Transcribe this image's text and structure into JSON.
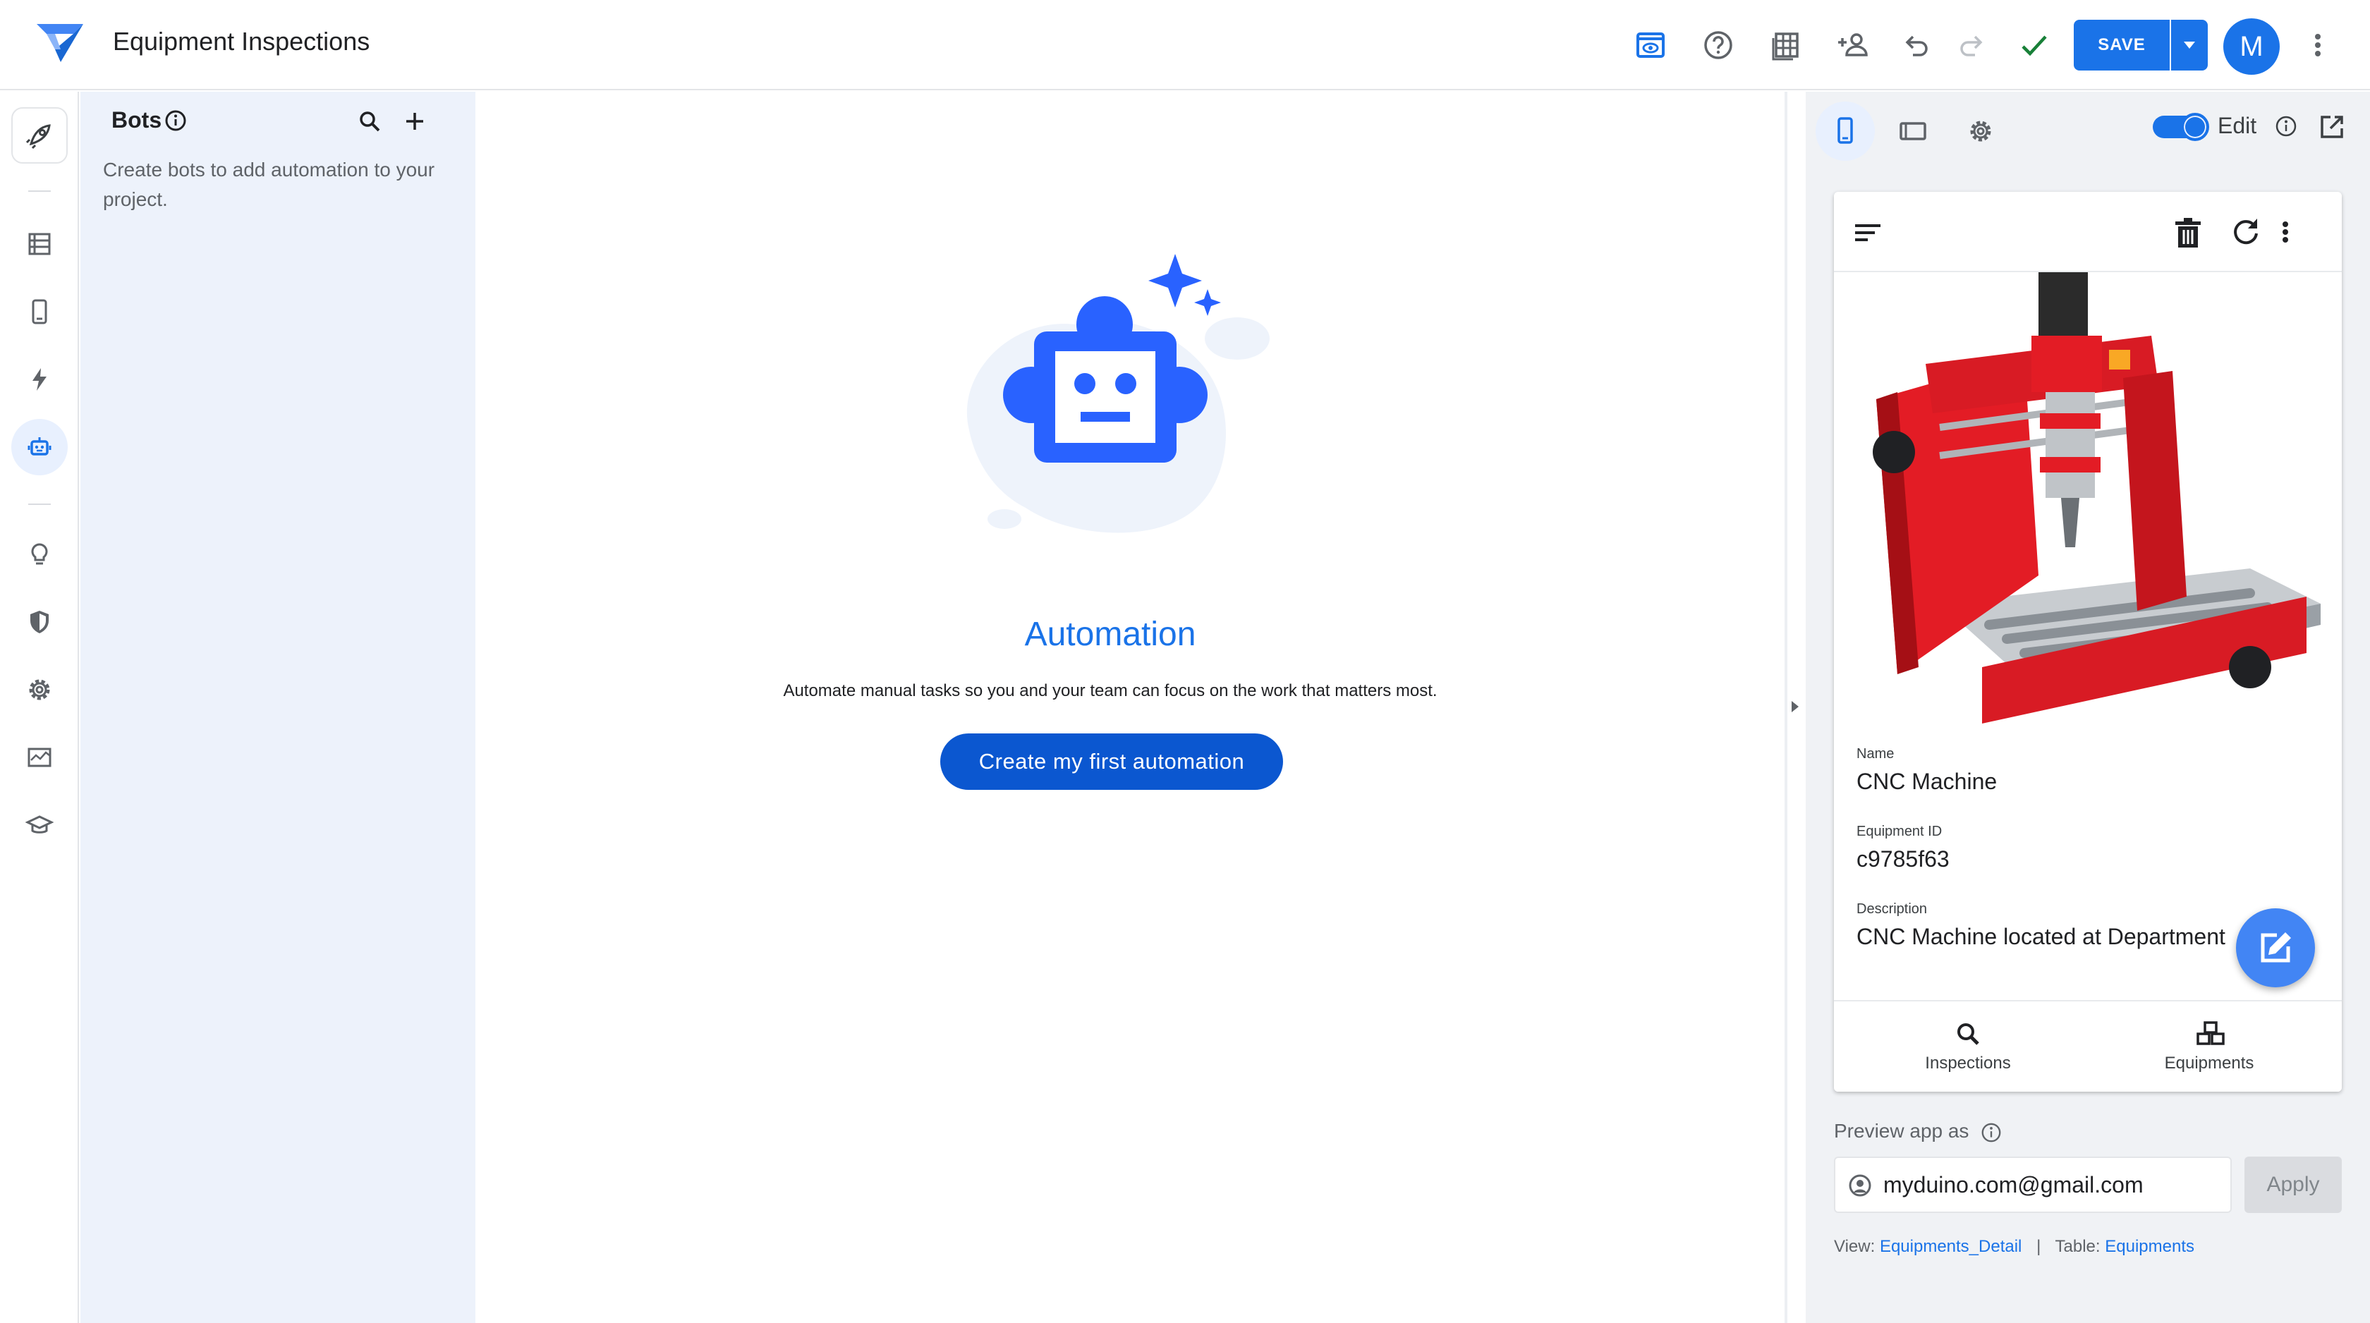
{
  "header": {
    "app_title": "Equipment Inspections",
    "save_label": "SAVE",
    "avatar_initial": "M",
    "icons": [
      "logo-icon",
      "preview-icon",
      "help-icon",
      "table-icon",
      "add-person-icon",
      "undo-icon",
      "redo-icon",
      "check-icon",
      "more-vert-icon"
    ]
  },
  "rail": {
    "items": [
      "rocket-icon",
      "data-icon",
      "mobile-icon",
      "actions-icon",
      "bots-icon",
      "insights-icon",
      "security-icon",
      "settings-icon",
      "monitor-icon",
      "learn-icon"
    ],
    "active": "bots-icon"
  },
  "bots_panel": {
    "title": "Bots",
    "description": "Create bots to add automation to your project."
  },
  "main": {
    "title": "Automation",
    "description": "Automate manual tasks so you and your team can focus on the work that matters most.",
    "cta_label": "Create my first automation"
  },
  "right_panel": {
    "edit_label": "Edit",
    "edit_toggle_on": true,
    "detail": {
      "fields": [
        {
          "label": "Name",
          "value": "CNC Machine"
        },
        {
          "label": "Equipment ID",
          "value": "c9785f63"
        },
        {
          "label": "Description",
          "value": "CNC Machine located at Department"
        }
      ]
    },
    "nav": [
      {
        "label": "Inspections",
        "icon": "search-icon"
      },
      {
        "label": "Equipments",
        "icon": "boxes-icon"
      }
    ],
    "preview_label": "Preview app as",
    "preview_email": "myduino.com@gmail.com",
    "apply_label": "Apply",
    "view_prefix": "View:",
    "view_name": "Equipments_Detail",
    "separator": "|",
    "table_prefix": "Table:",
    "table_name": "Equipments"
  },
  "colors": {
    "accent": "#1a73e8",
    "cta": "#0b57d0",
    "panel_bg": "#edf2fb",
    "success": "#188038"
  }
}
